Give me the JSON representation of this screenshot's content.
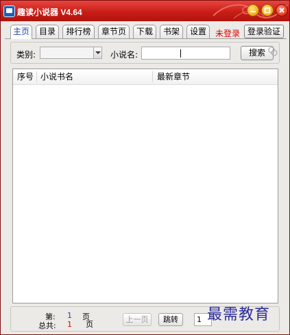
{
  "window": {
    "title": "趣读小说器 V4.64"
  },
  "tabs": [
    {
      "label": "主页",
      "active": true
    },
    {
      "label": "目录"
    },
    {
      "label": "排行榜"
    },
    {
      "label": "章节页"
    },
    {
      "label": "下载"
    },
    {
      "label": "书架"
    },
    {
      "label": "设置"
    }
  ],
  "status": {
    "login_state": "未登录"
  },
  "login_button": {
    "label": "登录验证"
  },
  "search": {
    "category_label": "类别:",
    "category_value": "",
    "name_label": "小说名:",
    "name_value": "",
    "button_label": "搜索"
  },
  "list": {
    "columns": [
      "序号",
      "小说书名",
      "最新章节"
    ],
    "rows": []
  },
  "footer": {
    "page_prefix": "第:",
    "page_current": "1",
    "page_unit": "页",
    "total_prefix": "总共:",
    "page_total": "1",
    "total_unit": "页",
    "prev_label": "上一页",
    "jump_label": "跳转",
    "page_input_value": "1"
  },
  "watermark": "最需教育",
  "colors": {
    "titlebar": "#c81d16",
    "active_tab_text": "#1a3fa8",
    "status_red": "#e00000",
    "watermark": "#2a2a9a"
  }
}
